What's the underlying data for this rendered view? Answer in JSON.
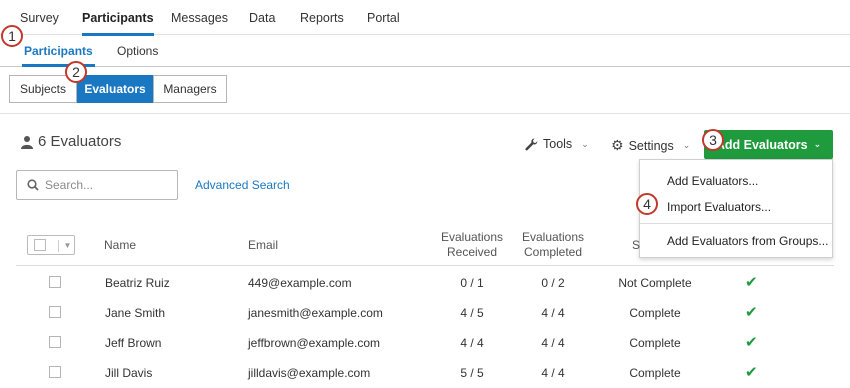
{
  "top_tabs": [
    "Survey",
    "Participants",
    "Messages",
    "Data",
    "Reports",
    "Portal"
  ],
  "sub_tabs": [
    "Participants",
    "Options"
  ],
  "segmented": [
    "Subjects",
    "Evaluators",
    "Managers"
  ],
  "callouts": [
    "1",
    "2",
    "3",
    "4"
  ],
  "header": {
    "count_label": "6 Evaluators",
    "tools_label": "Tools",
    "settings_label": "Settings",
    "add_label": "Add Evaluators"
  },
  "dropdown": [
    "Add Evaluators...",
    "Import Evaluators...",
    "Add Evaluators from Groups..."
  ],
  "search": {
    "placeholder": "Search...",
    "advanced_label": "Advanced Search"
  },
  "table": {
    "columns": {
      "name": "Name",
      "email": "Email",
      "received": [
        "Evaluations",
        "Received"
      ],
      "completed": [
        "Evaluations",
        "Completed"
      ],
      "status_partial": "S"
    },
    "rows": [
      {
        "name": "Beatriz Ruiz",
        "email": "449@example.com",
        "received": "0 / 1",
        "completed": "0 / 2",
        "status": "Not Complete"
      },
      {
        "name": "Jane Smith",
        "email": "janesmith@example.com",
        "received": "4 / 5",
        "completed": "4 / 4",
        "status": "Complete"
      },
      {
        "name": "Jeff Brown",
        "email": "jeffbrown@example.com",
        "received": "4 / 4",
        "completed": "4 / 4",
        "status": "Complete"
      },
      {
        "name": "Jill Davis",
        "email": "jilldavis@example.com",
        "received": "5 / 5",
        "completed": "4 / 4",
        "status": "Complete"
      }
    ]
  },
  "colors": {
    "accent": "#1a78c2",
    "add_button": "#1f9a3d",
    "callout_ring": "#c0392b",
    "check": "#1f9a3d"
  }
}
